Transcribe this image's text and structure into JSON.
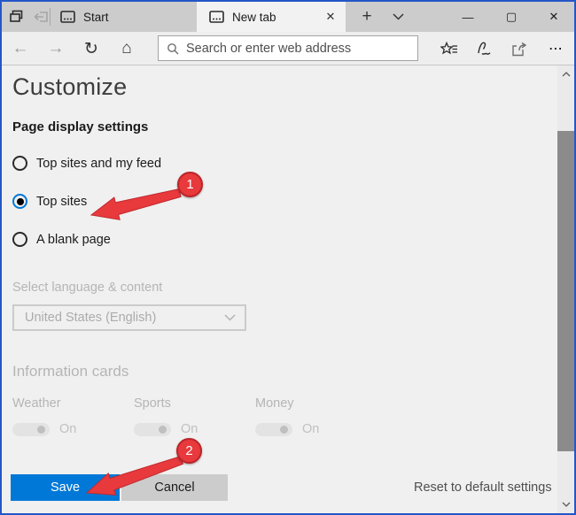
{
  "window_controls": {
    "minimize": "—",
    "maximize": "▢",
    "close": "✕"
  },
  "tabbar": {
    "start_tab": {
      "label": "Start"
    },
    "active_tab": {
      "label": "New tab",
      "close_glyph": "✕"
    },
    "new_tab_glyph": "+"
  },
  "navbar": {
    "back_glyph": "←",
    "forward_glyph": "→",
    "refresh_glyph": "↻",
    "home_glyph": "⌂",
    "search": {
      "placeholder": "Search or enter web address"
    },
    "more_glyph": "⋯"
  },
  "panel": {
    "title": "Customize",
    "page_display": {
      "heading": "Page display settings",
      "options": [
        {
          "label": "Top sites and my feed",
          "selected": false
        },
        {
          "label": "Top sites",
          "selected": true
        },
        {
          "label": "A blank page",
          "selected": false
        }
      ]
    },
    "language": {
      "label": "Select language & content",
      "value": "United States (English)"
    },
    "cards": {
      "heading": "Information cards",
      "items": [
        {
          "label": "Weather",
          "state": "On"
        },
        {
          "label": "Sports",
          "state": "On"
        },
        {
          "label": "Money",
          "state": "On"
        }
      ]
    },
    "buttons": {
      "save": "Save",
      "cancel": "Cancel",
      "reset": "Reset to default settings"
    }
  },
  "annotations": {
    "step1": "1",
    "step2": "2"
  },
  "colors": {
    "accent_blue": "#0078d7",
    "annotation_red": "#e8393d",
    "window_border": "#2456c8"
  }
}
